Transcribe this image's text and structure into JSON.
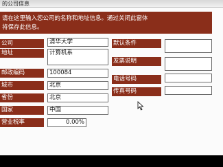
{
  "window": {
    "title": "的公司信息"
  },
  "info": {
    "line1": "请在这里输入您公司的名称和地址信息。通过关闭此窗体",
    "line2": "将保存此信息。"
  },
  "left": [
    {
      "label": "公司",
      "value": "清华大学"
    },
    {
      "label": "地址",
      "value": "计算机系"
    },
    {
      "label": "邮政编码",
      "value": "100084"
    },
    {
      "label": "城市",
      "value": "北京"
    },
    {
      "label": "省份",
      "value": "北京"
    },
    {
      "label": "国家",
      "value": "中国"
    },
    {
      "label": "营业税率",
      "value": "0.00%"
    }
  ],
  "right": [
    {
      "label": "默认条件",
      "value": ""
    },
    {
      "label": "发票说明",
      "value": ""
    },
    {
      "label": "电话号码",
      "value": ""
    },
    {
      "label": "传真号码",
      "value": ""
    }
  ]
}
